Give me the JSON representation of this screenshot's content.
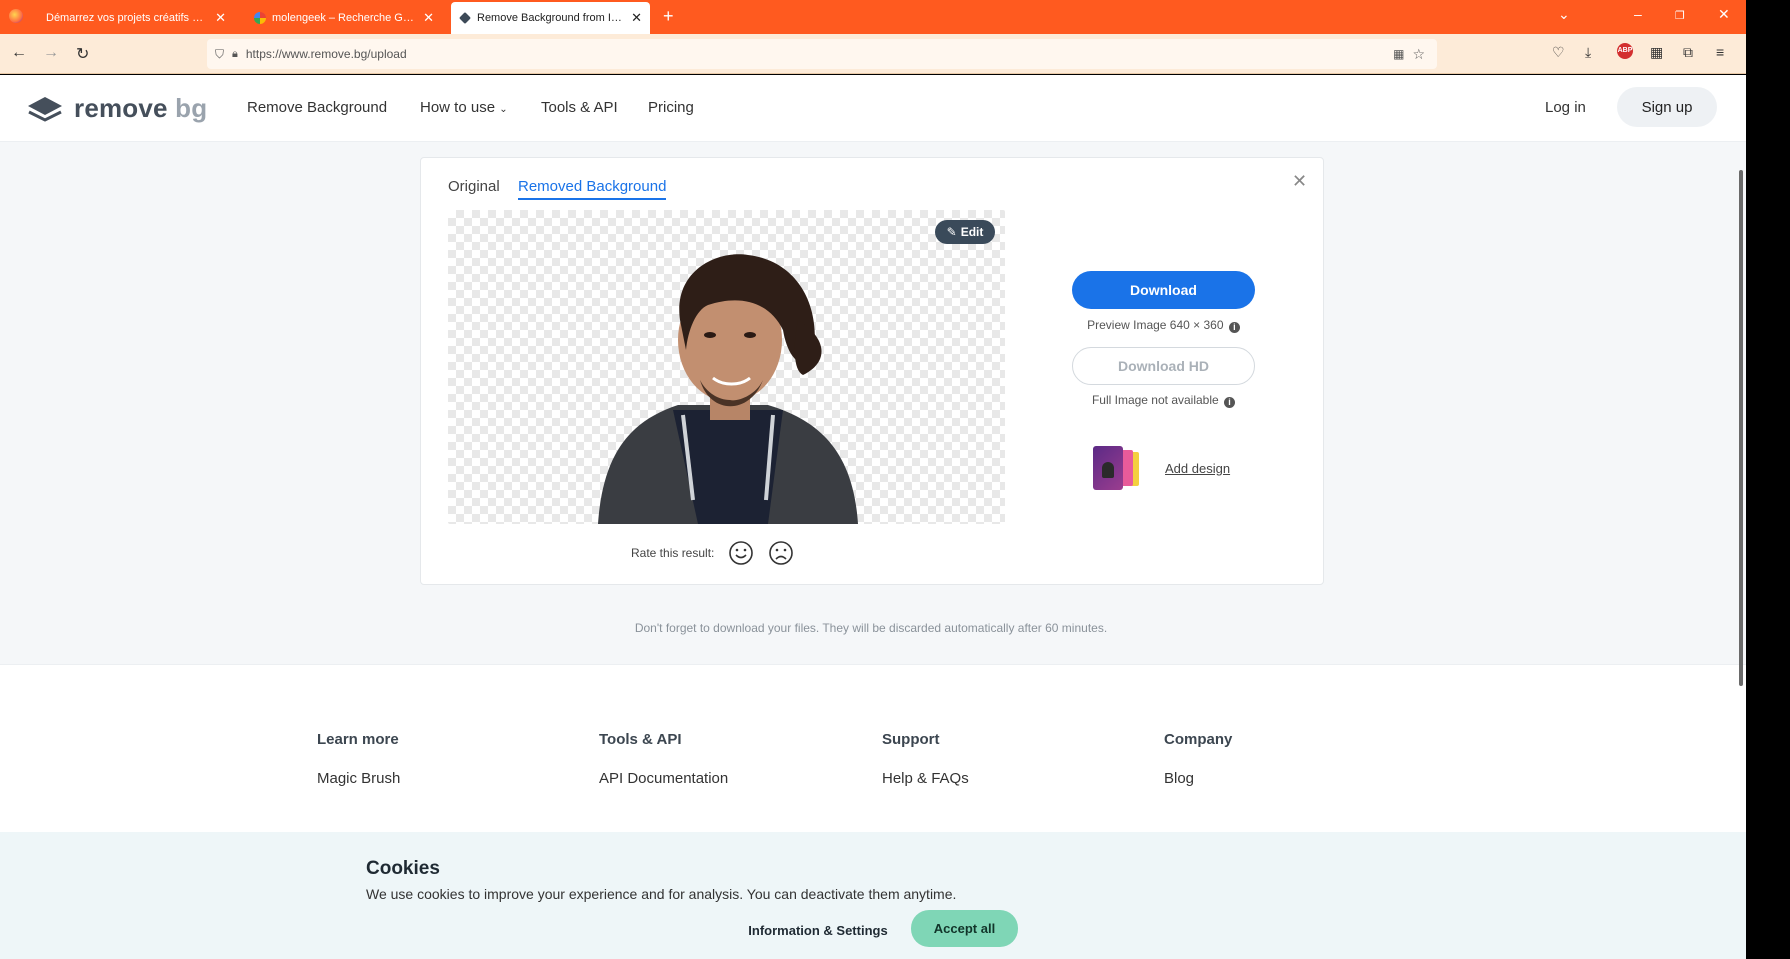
{
  "browser": {
    "tabs": [
      {
        "title": "Démarrez vos projets créatifs et télé",
        "active": false
      },
      {
        "title": "molengeek – Recherche Google",
        "active": false
      },
      {
        "title": "Remove Background from Imag",
        "active": true
      }
    ],
    "url": "https://www.remove.bg/upload"
  },
  "site": {
    "logo_main": "remove",
    "logo_suffix": "bg",
    "nav": [
      "Remove Background",
      "How to use",
      "Tools & API",
      "Pricing"
    ],
    "login": "Log in",
    "signup": "Sign up"
  },
  "card": {
    "tab_original": "Original",
    "tab_removed": "Removed Background",
    "edit": "Edit",
    "rate_label": "Rate this result:",
    "download": "Download",
    "preview_note": "Preview Image 640 × 360",
    "download_hd": "Download HD",
    "full_note": "Full Image not available",
    "add_design": "Add design"
  },
  "discard_note": "Don't forget to download your files. They will be discarded automatically after 60 minutes.",
  "footer": {
    "cols": [
      {
        "heading": "Learn more",
        "link": "Magic Brush"
      },
      {
        "heading": "Tools & API",
        "link": "API Documentation"
      },
      {
        "heading": "Support",
        "link": "Help & FAQs"
      },
      {
        "heading": "Company",
        "link": "Blog"
      }
    ]
  },
  "cookies": {
    "title": "Cookies",
    "text": "We use cookies to improve your experience and for analysis. You can deactivate them anytime.",
    "info_button": "Information & Settings",
    "accept_button": "Accept all"
  },
  "colors": {
    "browser_accent": "#ff5a1f",
    "primary_blue": "#1a73e8",
    "accept_green": "#7fd6b6"
  }
}
